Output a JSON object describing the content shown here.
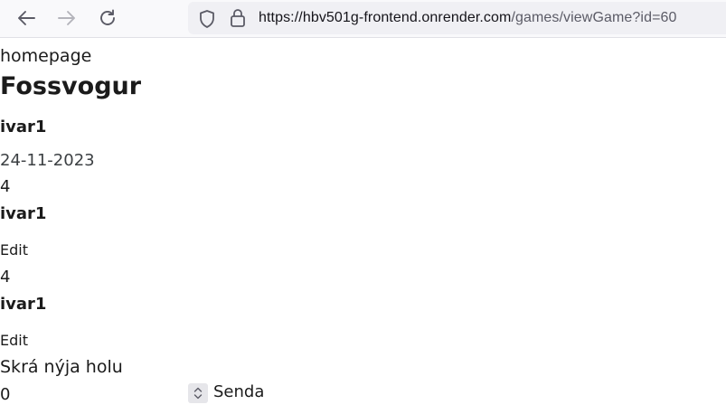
{
  "browser": {
    "url_host": "https://hbv501g-frontend.onrender.com",
    "url_path": "/games/viewGame?id=60",
    "icons": {
      "back": "arrow-left-icon",
      "forward": "arrow-right-icon",
      "reload": "reload-icon",
      "shield": "shield-icon",
      "lock": "lock-icon"
    }
  },
  "page": {
    "home_link": "homepage",
    "game_title": "Fossvogur",
    "owner": "ivar1",
    "date": "24-11-2023",
    "holes": [
      {
        "score": "4",
        "player": "ivar1",
        "edit_label": "Edit"
      },
      {
        "score": "4",
        "player": "ivar1",
        "edit_label": "Edit"
      }
    ],
    "new_hole_label": "Skrá nýja holu",
    "new_hole_value": "0",
    "submit_label": "Senda"
  }
}
